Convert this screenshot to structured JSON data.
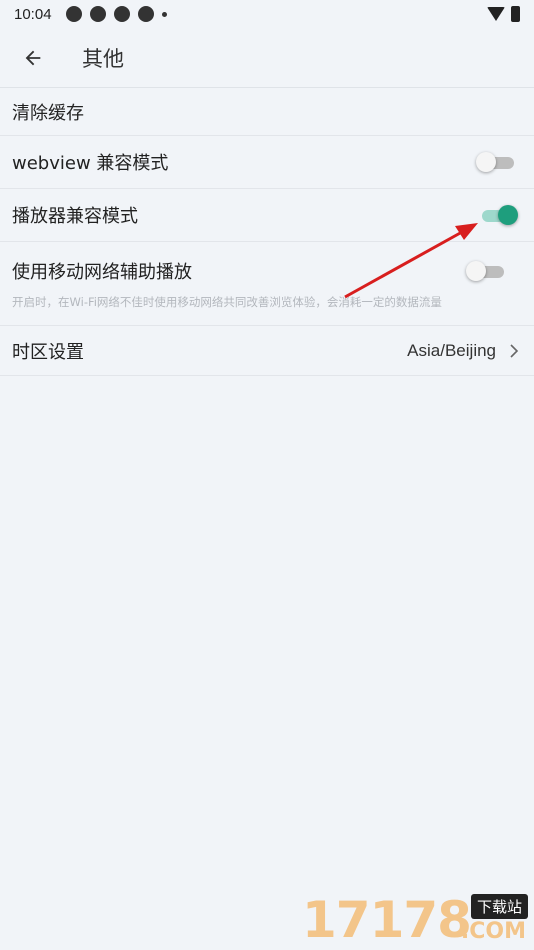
{
  "status_bar": {
    "time": "10:04"
  },
  "header": {
    "title": "其他"
  },
  "settings": {
    "clear_cache": "清除缓存",
    "webview_compat": {
      "label": "webview 兼容模式",
      "enabled": false
    },
    "player_compat": {
      "label": "播放器兼容模式",
      "enabled": true
    },
    "mobile_assist": {
      "label": "使用移动网络辅助播放",
      "description": "开启时，在Wi-Fi网络不佳时使用移动网络共同改善浏览体验，会消耗一定的数据流量",
      "enabled": false
    },
    "timezone": {
      "label": "时区设置",
      "value": "Asia/Beijing"
    }
  },
  "watermark": {
    "digits": "17178",
    "badge": "下载站",
    "domain": ".COM"
  },
  "colors": {
    "accent": "#1e9e7d",
    "accent_track": "#9ed8cc",
    "annotation_arrow": "#d81e1e",
    "background": "#f1f4f8"
  }
}
